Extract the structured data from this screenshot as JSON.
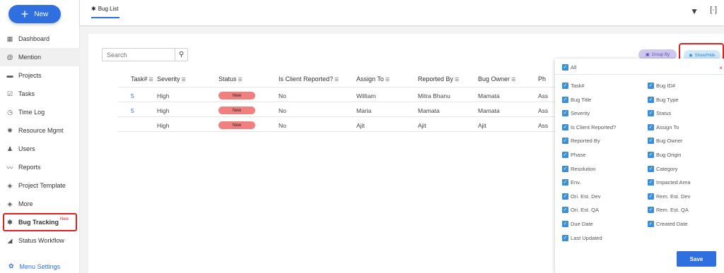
{
  "sidebar": {
    "new_label": "New",
    "items": [
      {
        "label": "Dashboard",
        "icon": "dashboard-icon",
        "glyph": "▦"
      },
      {
        "label": "Mention",
        "icon": "at-icon",
        "glyph": "@"
      },
      {
        "label": "Projects",
        "icon": "briefcase-icon",
        "glyph": "▬"
      },
      {
        "label": "Tasks",
        "icon": "tasks-icon",
        "glyph": "☑"
      },
      {
        "label": "Time Log",
        "icon": "clock-icon",
        "glyph": "◷"
      },
      {
        "label": "Resource Mgmt",
        "icon": "resource-icon",
        "glyph": "✺"
      },
      {
        "label": "Users",
        "icon": "user-icon",
        "glyph": "♟"
      },
      {
        "label": "Reports",
        "icon": "reports-icon",
        "glyph": "〰"
      },
      {
        "label": "Project Template",
        "icon": "layers-icon",
        "glyph": "◈"
      },
      {
        "label": "More",
        "icon": "more-icon",
        "glyph": "◈"
      },
      {
        "label": "Bug Tracking",
        "icon": "bug-icon",
        "glyph": "✱",
        "tag": "New"
      },
      {
        "label": "Status Workflow",
        "icon": "workflow-icon",
        "glyph": "◢"
      }
    ],
    "menu_settings": "Menu Settings"
  },
  "header": {
    "tab_label": "Bug List"
  },
  "toolbar": {
    "search_placeholder": "Search",
    "group_by": "Group By",
    "show_hide": "Show/Hide"
  },
  "table": {
    "columns": [
      "Task#",
      "Severity",
      "Status",
      "Is Client Reported?",
      "Assign To",
      "Reported By",
      "Bug Owner",
      "Ph"
    ],
    "rows": [
      {
        "task": "5",
        "severity": "High",
        "status": "New",
        "client": "No",
        "assign": "William",
        "reported": "Mitra Bhanu",
        "owner": "Mamata",
        "phase": "Ass"
      },
      {
        "task": "5",
        "severity": "High",
        "status": "New",
        "client": "No",
        "assign": "Maria",
        "reported": "Mamata",
        "owner": "Mamata",
        "phase": "Ass"
      },
      {
        "task": "",
        "severity": "High",
        "status": "New",
        "client": "No",
        "assign": "Ajit",
        "reported": "Ajit",
        "owner": "Ajit",
        "phase": "Ass"
      }
    ]
  },
  "panel": {
    "all_label": "All",
    "close": "×",
    "left": [
      "Task#",
      "Bug Title",
      "Severity",
      "Is Client Reported?",
      "Reported By",
      "Phase",
      "Resolution",
      "Env.",
      "Ori. Est. Dev",
      "Ori. Est. QA",
      "Due Date",
      "Last Updated"
    ],
    "right": [
      "Bug ID#",
      "Bug Type",
      "Status",
      "Assign To",
      "Bug Owner",
      "Bug Origin",
      "Category",
      "Impacted Area",
      "Rem. Est. Dev",
      "Rem. Est. QA",
      "Created Date"
    ],
    "save": "Save"
  },
  "colors": {
    "accent": "#2f6fe0",
    "highlight": "#e02020",
    "status_new": "#f07f7f",
    "checkbox": "#3a8fd8"
  }
}
